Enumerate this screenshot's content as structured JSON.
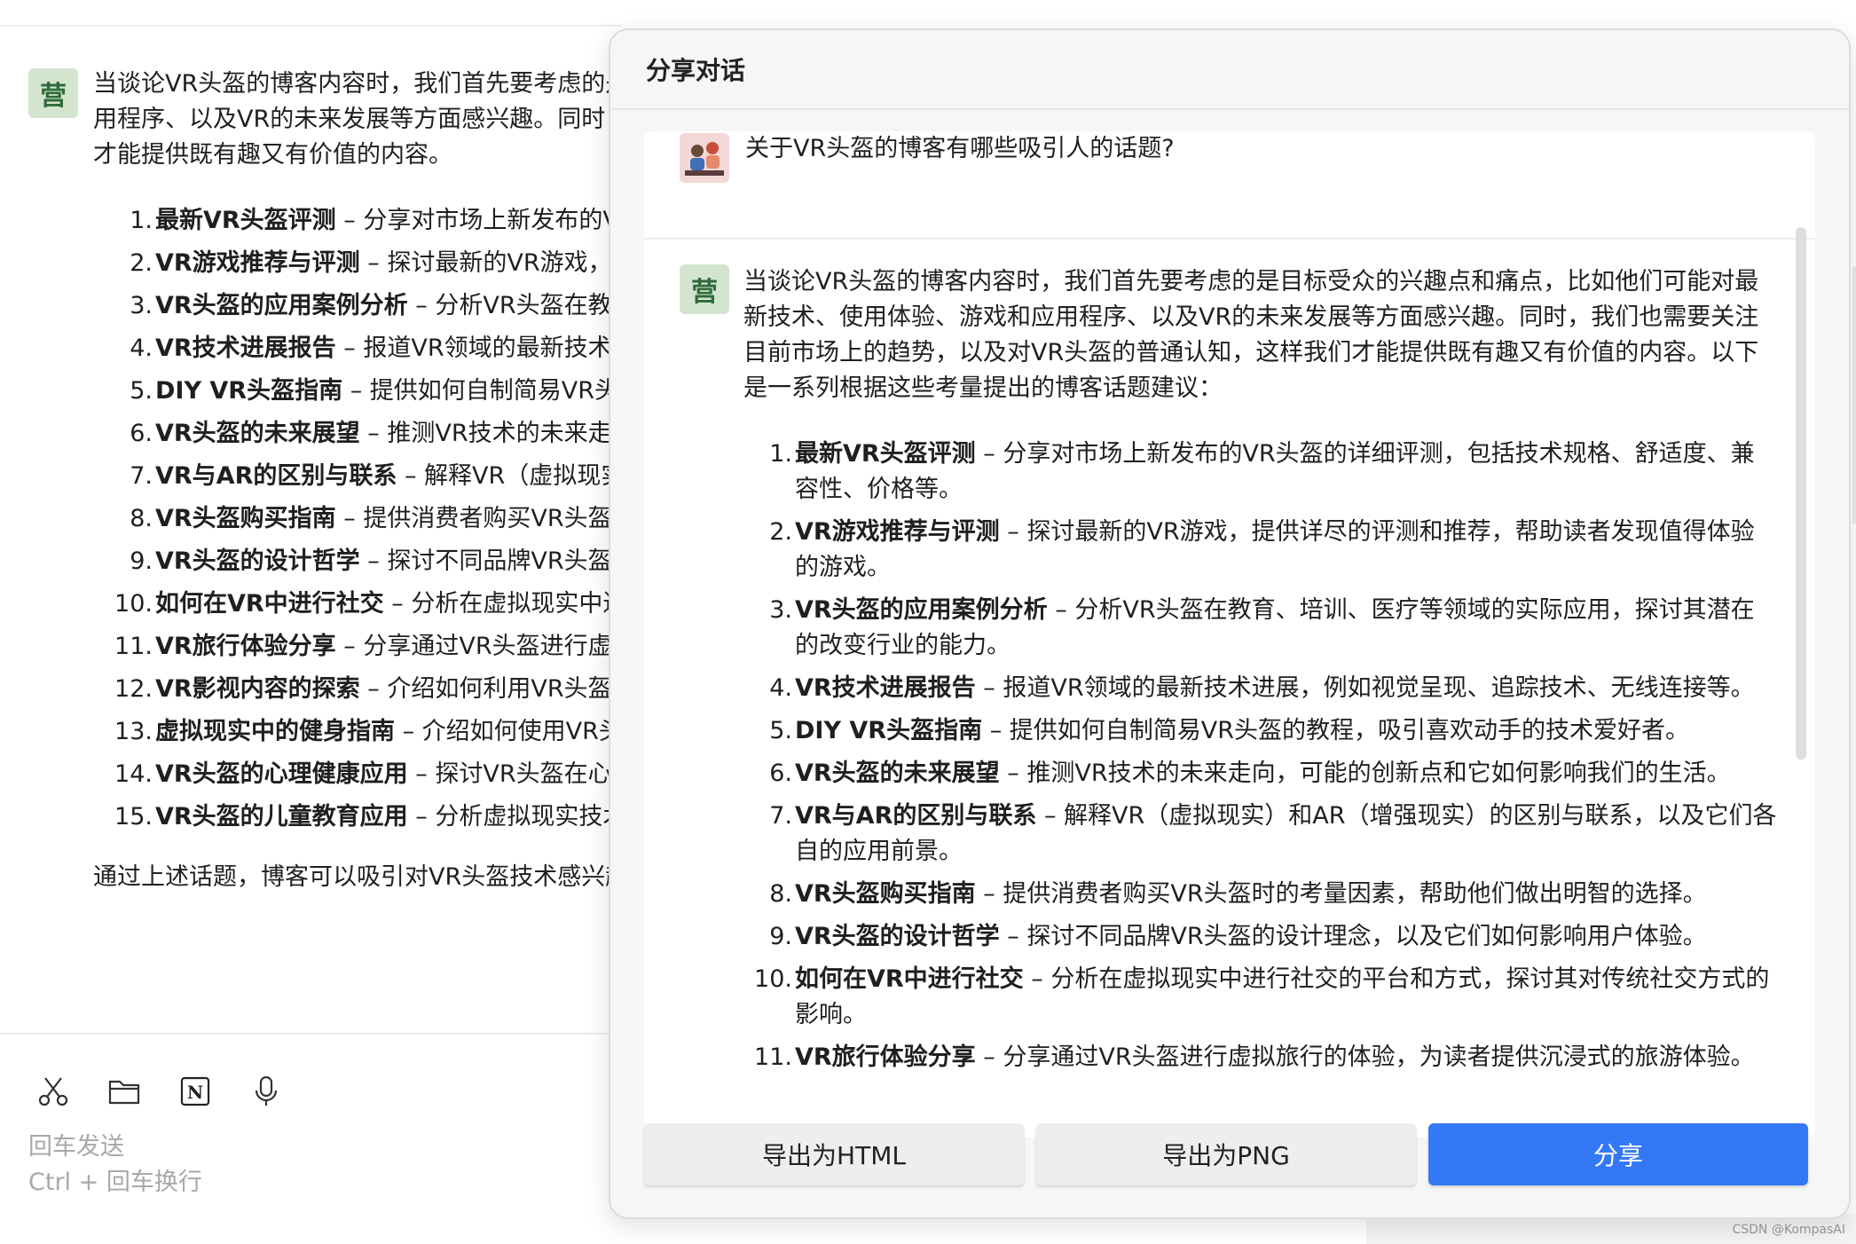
{
  "background_chat": {
    "avatar_char": "营",
    "intro": "当谈论VR头盔的博客内容时，我们首先要考虑的是目标受众的兴趣点和痛点，比如他们可能对最新技术、使用体验、游戏和应用程序、以及VR的未来发展等方面感兴趣。同时，我们也需要关注目前市场上的趋势，以及对VR头盔的普通认知，这样我们才能提供既有趣又有价值的内容。",
    "items": [
      {
        "num": "1.",
        "title": "最新VR头盔评测",
        "desc": " – 分享对市场上新发布的VR头盔的详细评测"
      },
      {
        "num": "2.",
        "title": "VR游戏推荐与评测",
        "desc": " – 探讨最新的VR游戏，提供详尽的评测和推荐"
      },
      {
        "num": "3.",
        "title": "VR头盔的应用案例分析",
        "desc": " – 分析VR头盔在教育、培训、医疗等领域的实际应用，探讨其潜在的改变行业的能力。"
      },
      {
        "num": "4.",
        "title": "VR技术进展报告",
        "desc": " – 报道VR领域的最新技术进展"
      },
      {
        "num": "5.",
        "title": "DIY VR头盔指南",
        "desc": " – 提供如何自制简易VR头盔的教程"
      },
      {
        "num": "6.",
        "title": "VR头盔的未来展望",
        "desc": " – 推测VR技术的未来走向"
      },
      {
        "num": "7.",
        "title": "VR与AR的区别与联系",
        "desc": " – 解释VR（虚拟现实）和AR（增强现实）的区别与联系，以及它们各自的应用前景。"
      },
      {
        "num": "8.",
        "title": "VR头盔购买指南",
        "desc": " – 提供消费者购买VR头盔时的考量因素"
      },
      {
        "num": "9.",
        "title": "VR头盔的设计哲学",
        "desc": " – 探讨不同品牌VR头盔的设计理念"
      },
      {
        "num": "10.",
        "title": "如何在VR中进行社交",
        "desc": " – 分析在虚拟现实中进行社交的平台和方式"
      },
      {
        "num": "11.",
        "title": "VR旅行体验分享",
        "desc": " – 分享通过VR头盔进行虚拟旅行的体验"
      },
      {
        "num": "12.",
        "title": "VR影视内容的探索",
        "desc": " – 介绍如何利用VR头盔观看影视内容"
      },
      {
        "num": "13.",
        "title": "虚拟现实中的健身指南",
        "desc": " – 介绍如何使用VR头盔进行健身"
      },
      {
        "num": "14.",
        "title": "VR头盔的心理健康应用",
        "desc": " – 探讨VR头盔在心理健康领域的应用"
      },
      {
        "num": "15.",
        "title": "VR头盔的儿童教育应用",
        "desc": " – 分析虚拟现实技术在儿童教育中的应用"
      }
    ],
    "outro": "通过上述话题，博客可以吸引对VR头盔技术感兴趣的读者。每个话题都需要深入研究和创造性地呈现，"
  },
  "input_area": {
    "hint_send": "回车发送",
    "hint_newline": "Ctrl + 回车换行",
    "tools": [
      "scissors-icon",
      "folder-icon",
      "notion-icon",
      "microphone-icon"
    ]
  },
  "modal": {
    "title": "分享对话",
    "user_question": "关于VR头盔的博客有哪些吸引人的话题?",
    "assistant_avatar_char": "营",
    "assistant_intro": "当谈论VR头盔的博客内容时，我们首先要考虑的是目标受众的兴趣点和痛点，比如他们可能对最新技术、使用体验、游戏和应用程序、以及VR的未来发展等方面感兴趣。同时，我们也需要关注目前市场上的趋势，以及对VR头盔的普通认知，这样我们才能提供既有趣又有价值的内容。以下是一系列根据这些考量提出的博客话题建议：",
    "items": [
      {
        "num": "1.",
        "title": "最新VR头盔评测",
        "desc": " – 分享对市场上新发布的VR头盔的详细评测，包括技术规格、舒适度、兼容性、价格等。"
      },
      {
        "num": "2.",
        "title": "VR游戏推荐与评测",
        "desc": " – 探讨最新的VR游戏，提供详尽的评测和推荐，帮助读者发现值得体验的游戏。"
      },
      {
        "num": "3.",
        "title": "VR头盔的应用案例分析",
        "desc": " – 分析VR头盔在教育、培训、医疗等领域的实际应用，探讨其潜在的改变行业的能力。"
      },
      {
        "num": "4.",
        "title": "VR技术进展报告",
        "desc": " – 报道VR领域的最新技术进展，例如视觉呈现、追踪技术、无线连接等。"
      },
      {
        "num": "5.",
        "title": "DIY VR头盔指南",
        "desc": " – 提供如何自制简易VR头盔的教程，吸引喜欢动手的技术爱好者。"
      },
      {
        "num": "6.",
        "title": "VR头盔的未来展望",
        "desc": " – 推测VR技术的未来走向，可能的创新点和它如何影响我们的生活。"
      },
      {
        "num": "7.",
        "title": "VR与AR的区别与联系",
        "desc": " – 解释VR（虚拟现实）和AR（增强现实）的区别与联系，以及它们各自的应用前景。"
      },
      {
        "num": "8.",
        "title": "VR头盔购买指南",
        "desc": " – 提供消费者购买VR头盔时的考量因素，帮助他们做出明智的选择。"
      },
      {
        "num": "9.",
        "title": "VR头盔的设计哲学",
        "desc": " – 探讨不同品牌VR头盔的设计理念，以及它们如何影响用户体验。"
      },
      {
        "num": "10.",
        "title": "如何在VR中进行社交",
        "desc": " – 分析在虚拟现实中进行社交的平台和方式，探讨其对传统社交方式的影响。"
      },
      {
        "num": "11.",
        "title": "VR旅行体验分享",
        "desc": " – 分享通过VR头盔进行虚拟旅行的体验，为读者提供沉浸式的旅游体验。"
      }
    ],
    "buttons": {
      "export_html": "导出为HTML",
      "export_png": "导出为PNG",
      "share": "分享"
    }
  },
  "watermark": "CSDN @KompasAI",
  "colors": {
    "primary_button": "#3478f6",
    "avatar_bg": "#d3e5cf",
    "avatar_fg": "#2f6a3a"
  }
}
